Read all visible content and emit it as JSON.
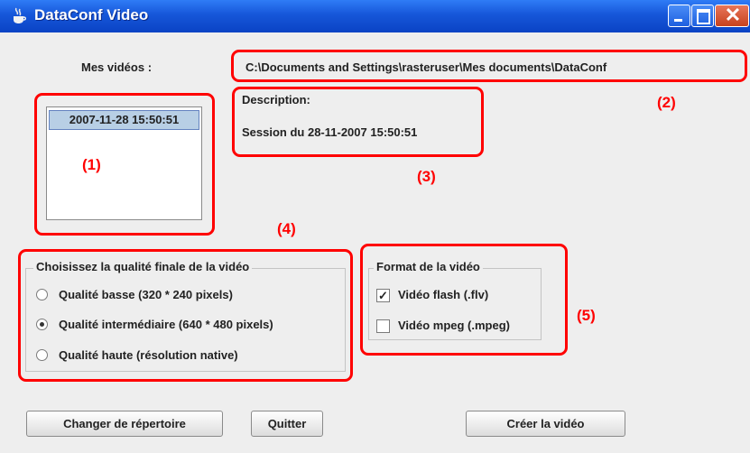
{
  "window": {
    "title": "DataConf Video"
  },
  "videos": {
    "label": "Mes vidéos :",
    "path": "C:\\Documents and Settings\\rasteruser\\Mes documents\\DataConf",
    "items": [
      {
        "label": "2007-11-28 15:50:51",
        "selected": true
      }
    ]
  },
  "description": {
    "title": "Description:",
    "text": "Session du 28-11-2007 15:50:51"
  },
  "quality": {
    "title": "Choisissez la qualité finale de la vidéo",
    "options": [
      {
        "label": "Qualité basse (320 * 240 pixels)",
        "selected": false
      },
      {
        "label": "Qualité intermédiaire (640 * 480 pixels)",
        "selected": true
      },
      {
        "label": "Qualité haute (résolution native)",
        "selected": false
      }
    ]
  },
  "format": {
    "title": "Format de la vidéo",
    "options": [
      {
        "label": "Vidéo flash (.flv)",
        "checked": true
      },
      {
        "label": "Vidéo mpeg (.mpeg)",
        "checked": false
      }
    ]
  },
  "buttons": {
    "change_dir": "Changer de répertoire",
    "quit": "Quitter",
    "create": "Créer la vidéo"
  },
  "annotations": {
    "a1": "(1)",
    "a2": "(2)",
    "a3": "(3)",
    "a4": "(4)",
    "a5": "(5)"
  },
  "colors": {
    "annotation": "#ff0000",
    "titlebar": "#1656d9",
    "selection": "#b8cfe5"
  }
}
